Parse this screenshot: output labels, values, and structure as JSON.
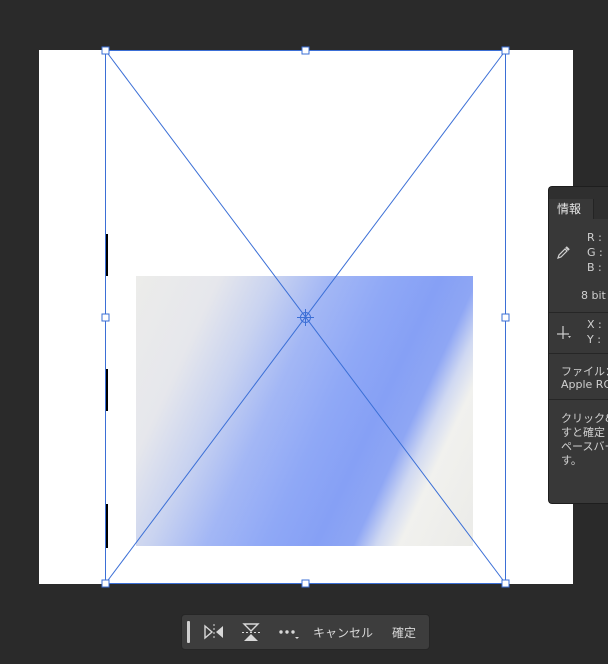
{
  "info_panel": {
    "tab_label": "情報",
    "rgb_labels": [
      "R :",
      "G :",
      "B :"
    ],
    "bit_depth": "8 bit",
    "xy_labels": [
      "X :",
      "Y :"
    ],
    "file_label": "ファイル：",
    "color_profile": "Apple RG",
    "help_lines": [
      "クリック&",
      "すと確定",
      "ペースバー",
      "す。"
    ]
  },
  "toolbar": {
    "cancel_label": "キャンセル",
    "commit_label": "確定"
  },
  "colors": {
    "transform_line": "#3b6fd6",
    "gradient_blue": "#86a0f5",
    "canvas_bg": "#2a2a2a"
  }
}
